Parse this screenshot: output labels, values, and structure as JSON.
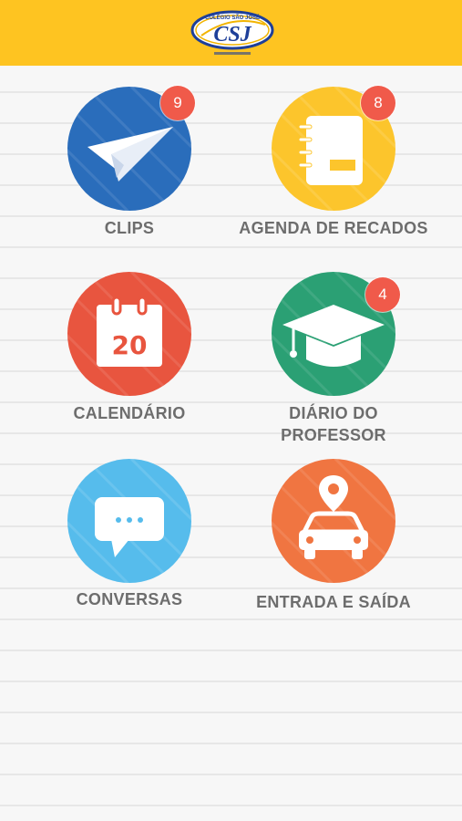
{
  "header": {
    "logo_text": "COLÉGIO SÃO JOSÉ",
    "logo_monogram": "CSJ",
    "bg_color": "#fec421"
  },
  "menu": [
    {
      "label": "CLIPS",
      "icon": "paper-plane-icon",
      "badge": "9",
      "color": "#2a6dbb"
    },
    {
      "label": "AGENDA DE RECADOS",
      "icon": "notebook-icon",
      "badge": "8",
      "color": "#fcc52c"
    },
    {
      "label": "CALENDÁRIO",
      "icon": "calendar-icon",
      "day": "20",
      "color": "#e8553f"
    },
    {
      "label_line1": "DIÁRIO DO",
      "label_line2": "PROFESSOR",
      "icon": "graduation-cap-icon",
      "badge": "4",
      "color": "#2ba074"
    },
    {
      "label": "CONVERSAS",
      "icon": "chat-bubble-icon",
      "color": "#56bcec"
    },
    {
      "label": "ENTRADA E SAÍDA",
      "icon": "car-location-icon",
      "color": "#f07541"
    }
  ],
  "badge_color": "#f05a4a"
}
